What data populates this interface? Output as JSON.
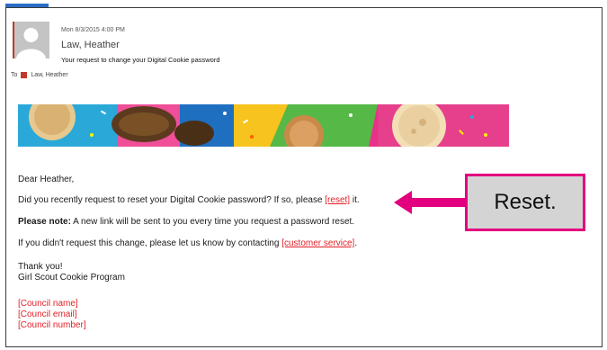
{
  "header": {
    "date": "Mon 8/3/2015 4:00 PM",
    "sender": "Law, Heather",
    "subject": "Your request to change your Digital Cookie password",
    "to_label": "To",
    "to_name": "Law, Heather"
  },
  "email": {
    "greeting": "Dear Heather,",
    "line1_prefix": "Did you recently request to reset your Digital Cookie password? If so, please ",
    "line1_link": "[reset]",
    "line1_suffix": " it.",
    "note_bold": "Please note:",
    "note_text": " A new link will be sent to you every time you request a password reset.",
    "line3_prefix": "If you didn't request this change, please let us know by contacting ",
    "line3_link": "[customer service]",
    "line3_suffix": ".",
    "thanks": "Thank you!",
    "signature": "Girl Scout Cookie Program",
    "council_name": "[Council name]",
    "council_email": "[Council email]",
    "council_number": "[Council number]"
  },
  "callout": {
    "label": "Reset."
  },
  "colors": {
    "link_red": "#e21f26",
    "callout_border": "#e3007e",
    "accent_blue": "#2b6cc4"
  }
}
